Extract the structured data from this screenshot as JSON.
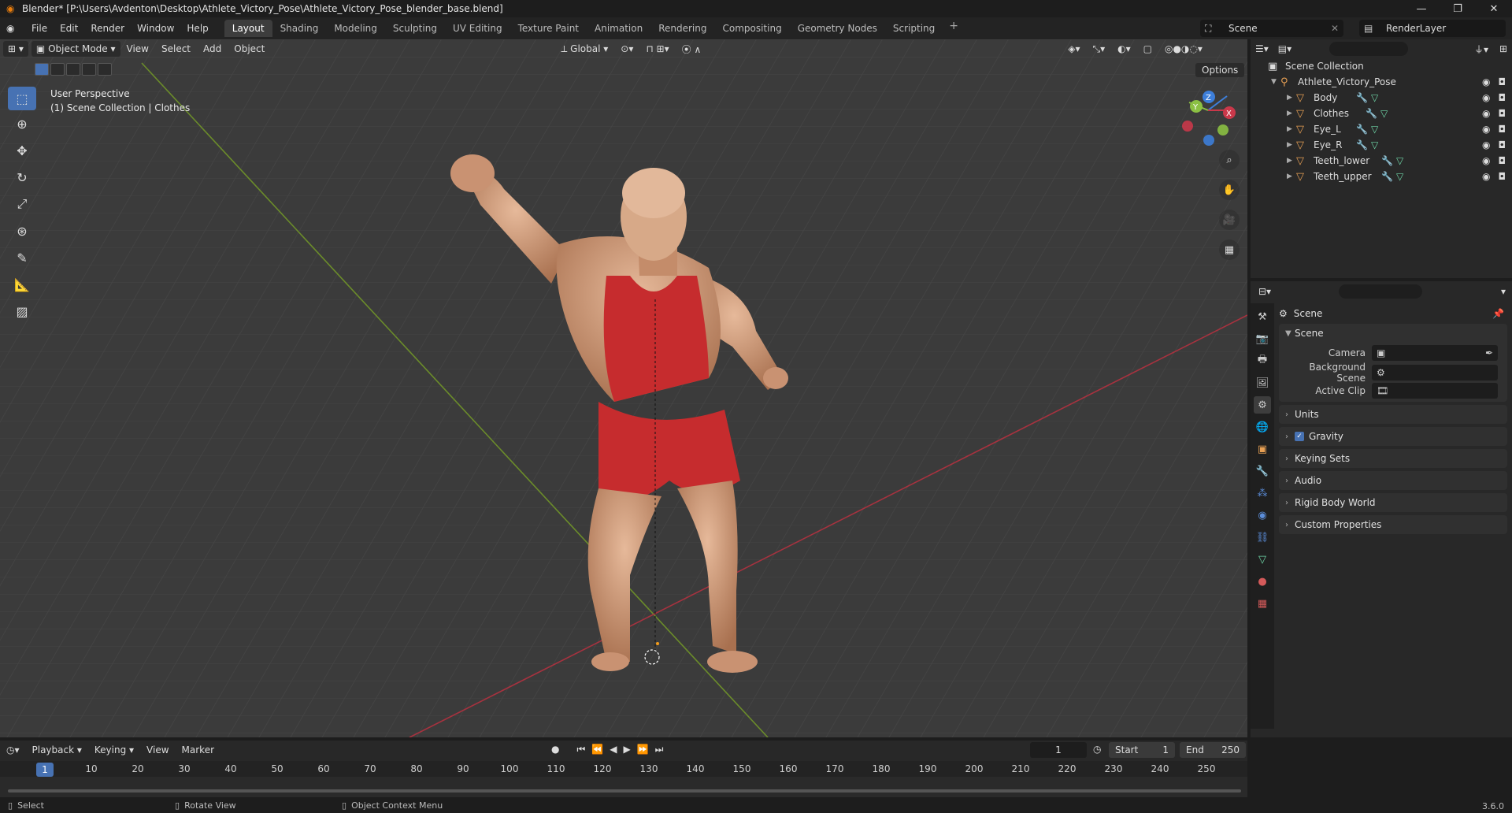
{
  "window": {
    "title": "Blender* [P:\\Users\\Avdenton\\Desktop\\Athlete_Victory_Pose\\Athlete_Victory_Pose_blender_base.blend]",
    "controls": [
      "—",
      "❐",
      "✕"
    ]
  },
  "menu": {
    "items": [
      "File",
      "Edit",
      "Render",
      "Window",
      "Help"
    ],
    "workspaces": [
      "Layout",
      "Shading",
      "Modeling",
      "Sculpting",
      "UV Editing",
      "Texture Paint",
      "Animation",
      "Rendering",
      "Compositing",
      "Geometry Nodes",
      "Scripting"
    ],
    "active_workspace": "Layout",
    "scene": "Scene",
    "view_layer": "RenderLayer"
  },
  "viewport": {
    "mode": "Object Mode",
    "menus": [
      "View",
      "Select",
      "Add",
      "Object"
    ],
    "transform_orientation": "Global",
    "options_label": "Options",
    "info_line1": "User Perspective",
    "info_line2": "(1) Scene Collection | Clothes",
    "gizmo_axes": [
      "X",
      "Y",
      "Z"
    ]
  },
  "outliner": {
    "root": "Scene Collection",
    "collection": "Athlete_Victory_Pose",
    "objects": [
      {
        "name": "Body"
      },
      {
        "name": "Clothes"
      },
      {
        "name": "Eye_L"
      },
      {
        "name": "Eye_R"
      },
      {
        "name": "Teeth_lower"
      },
      {
        "name": "Teeth_upper"
      }
    ]
  },
  "properties": {
    "context": "Scene",
    "panel_scene": "Scene",
    "camera_label": "Camera",
    "background_scene_label": "Background Scene",
    "active_clip_label": "Active Clip",
    "panels": [
      "Units",
      "Gravity",
      "Keying Sets",
      "Audio",
      "Rigid Body World",
      "Custom Properties"
    ]
  },
  "timeline": {
    "menus": [
      "Playback",
      "Keying",
      "View",
      "Marker"
    ],
    "current_frame": "1",
    "start_label": "Start",
    "start": "1",
    "end_label": "End",
    "end": "250",
    "ticks": [
      "1",
      "10",
      "20",
      "30",
      "40",
      "50",
      "60",
      "70",
      "80",
      "90",
      "100",
      "110",
      "120",
      "130",
      "140",
      "150",
      "160",
      "170",
      "180",
      "190",
      "200",
      "210",
      "220",
      "230",
      "240",
      "250"
    ]
  },
  "status": {
    "select": "Select",
    "rotate": "Rotate View",
    "context_menu": "Object Context Menu",
    "version": "3.6.0"
  },
  "colors": {
    "accent": "#4772b3",
    "object_orange": "#e8a054",
    "x_axis": "#c9384a",
    "y_axis": "#8bc043",
    "z_axis": "#3d7ed9"
  }
}
